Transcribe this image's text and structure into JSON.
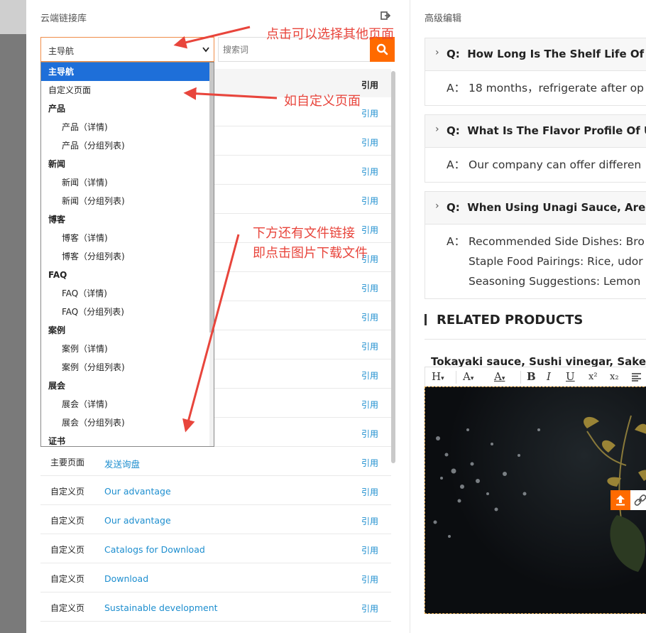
{
  "left_panel": {
    "title": "云端链接库",
    "select_value": "主导航",
    "search_placeholder": "搜索词",
    "ref_header": "引用",
    "dropdown_options": [
      {
        "label": "主导航",
        "kind": "selected"
      },
      {
        "label": "自定义页面",
        "kind": "item"
      },
      {
        "label": "产品",
        "kind": "group"
      },
      {
        "label": "产品（详情)",
        "kind": "child"
      },
      {
        "label": "产品（分组列表)",
        "kind": "child"
      },
      {
        "label": "新闻",
        "kind": "group"
      },
      {
        "label": "新闻（详情)",
        "kind": "child"
      },
      {
        "label": "新闻（分组列表)",
        "kind": "child"
      },
      {
        "label": "博客",
        "kind": "group"
      },
      {
        "label": "博客（详情)",
        "kind": "child"
      },
      {
        "label": "博客（分组列表)",
        "kind": "child"
      },
      {
        "label": "FAQ",
        "kind": "group"
      },
      {
        "label": "FAQ（详情)",
        "kind": "child"
      },
      {
        "label": "FAQ（分组列表)",
        "kind": "child"
      },
      {
        "label": "案例",
        "kind": "group"
      },
      {
        "label": "案例（详情)",
        "kind": "child"
      },
      {
        "label": "案例（分组列表)",
        "kind": "child"
      },
      {
        "label": "展会",
        "kind": "group"
      },
      {
        "label": "展会（详情)",
        "kind": "child"
      },
      {
        "label": "展会（分组列表)",
        "kind": "child"
      },
      {
        "label": "证书",
        "kind": "group"
      }
    ],
    "rows": [
      {
        "type": "",
        "name": "",
        "ref": "引用"
      },
      {
        "type": "",
        "name": "",
        "ref": "引用"
      },
      {
        "type": "",
        "name": "",
        "ref": "引用"
      },
      {
        "type": "",
        "name": "",
        "ref": "引用"
      },
      {
        "type": "",
        "name": "",
        "ref": "引用"
      },
      {
        "type": "",
        "name": "",
        "ref": "引用"
      },
      {
        "type": "",
        "name": "",
        "ref": "引用"
      },
      {
        "type": "",
        "name": "",
        "ref": "引用"
      },
      {
        "type": "",
        "name": "",
        "ref": "引用"
      },
      {
        "type": "",
        "name": "",
        "ref": "引用"
      },
      {
        "type": "",
        "name": "",
        "ref": "引用"
      },
      {
        "type": "",
        "name": "",
        "ref": "引用"
      },
      {
        "type": "主要页面",
        "name": "发送询盘",
        "ref": "引用"
      },
      {
        "type": "自定义页",
        "name": "Our advantage",
        "ref": "引用"
      },
      {
        "type": "自定义页",
        "name": "Our advantage",
        "ref": "引用"
      },
      {
        "type": "自定义页",
        "name": "Catalogs for Download",
        "ref": "引用"
      },
      {
        "type": "自定义页",
        "name": "Download",
        "ref": "引用"
      },
      {
        "type": "自定义页",
        "name": "Sustainable development",
        "ref": "引用"
      }
    ]
  },
  "annotations": {
    "select_other_page": "点击可以选择其他页面",
    "custom_page": "如自定义页面",
    "file_link_line1": "下方还有文件链接",
    "file_link_line2": "即点击图片下载文件",
    "color": "#e8453c"
  },
  "right_panel": {
    "title": "高级编辑",
    "faqs": [
      {
        "q_label": "Q:",
        "question": "How Long Is The Shelf Life Of T",
        "a_label": "A：",
        "answer_lines": [
          "18 months，refrigerate after op"
        ]
      },
      {
        "q_label": "Q:",
        "question": "What Is The Flavor Profile Of U",
        "a_label": "A：",
        "answer_lines": [
          "Our company can offer differen"
        ]
      },
      {
        "q_label": "Q:",
        "question": "When Using Unagi Sauce, Are T",
        "a_label": "A：",
        "answer_lines": [
          "Recommended Side Dishes: Bro",
          "Staple Food Pairings: Rice, udor",
          "Seasoning Suggestions: Lemon"
        ]
      }
    ],
    "related_title": "RELATED PRODUCTS",
    "product_names": "Tokayaki sauce,  Sushi vinegar,  Sake",
    "toolbar": [
      "H",
      "A",
      "A",
      "B",
      "I",
      "U",
      "x²",
      "x₂"
    ]
  },
  "colors": {
    "accent_orange": "#ff6a00",
    "link_blue": "#1d8ecf",
    "selected_blue": "#1e6fd9"
  },
  "icons": {
    "exit": "exit-icon",
    "search": "search-icon",
    "upload": "upload-icon",
    "link": "link-icon"
  }
}
